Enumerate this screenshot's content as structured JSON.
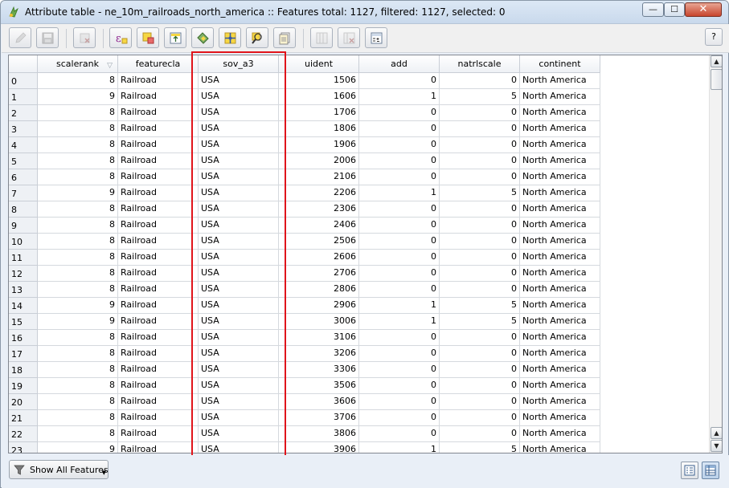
{
  "window": {
    "title": "Attribute table - ne_10m_railroads_north_america :: Features total: 1127, filtered: 1127, selected: 0",
    "min_glyph": "—",
    "max_glyph": "☐",
    "close_glyph": "✕"
  },
  "toolbar": {
    "buttons": [
      {
        "icon": "pencil-icon",
        "enabled": false
      },
      {
        "icon": "save-icon",
        "enabled": false
      },
      {
        "icon": "delete-selected-icon",
        "enabled": false
      },
      {
        "icon": "expression-select-icon",
        "enabled": true
      },
      {
        "icon": "deselect-all-icon",
        "enabled": true
      },
      {
        "icon": "move-selection-top-icon",
        "enabled": true
      },
      {
        "icon": "invert-selection-icon",
        "enabled": true
      },
      {
        "icon": "pan-to-selected-icon",
        "enabled": true
      },
      {
        "icon": "zoom-to-selected-icon",
        "enabled": true
      },
      {
        "icon": "copy-rows-icon",
        "enabled": true
      },
      {
        "icon": "new-column-icon",
        "enabled": false
      },
      {
        "icon": "delete-column-icon",
        "enabled": false
      },
      {
        "icon": "field-calculator-icon",
        "enabled": true
      }
    ],
    "help_label": "?"
  },
  "table": {
    "columns": [
      "scalerank",
      "featurecla",
      "sov_a3",
      "uident",
      "add",
      "natrlscale",
      "continent"
    ],
    "sorted_column": "scalerank",
    "rows": [
      {
        "id": "0",
        "scalerank": "8",
        "featurecla": "Railroad",
        "sov_a3": "USA",
        "uident": "1506",
        "add": "0",
        "natrlscale": "0",
        "continent": "North America"
      },
      {
        "id": "1",
        "scalerank": "9",
        "featurecla": "Railroad",
        "sov_a3": "USA",
        "uident": "1606",
        "add": "1",
        "natrlscale": "5",
        "continent": "North America"
      },
      {
        "id": "2",
        "scalerank": "8",
        "featurecla": "Railroad",
        "sov_a3": "USA",
        "uident": "1706",
        "add": "0",
        "natrlscale": "0",
        "continent": "North America"
      },
      {
        "id": "3",
        "scalerank": "8",
        "featurecla": "Railroad",
        "sov_a3": "USA",
        "uident": "1806",
        "add": "0",
        "natrlscale": "0",
        "continent": "North America"
      },
      {
        "id": "4",
        "scalerank": "8",
        "featurecla": "Railroad",
        "sov_a3": "USA",
        "uident": "1906",
        "add": "0",
        "natrlscale": "0",
        "continent": "North America"
      },
      {
        "id": "5",
        "scalerank": "8",
        "featurecla": "Railroad",
        "sov_a3": "USA",
        "uident": "2006",
        "add": "0",
        "natrlscale": "0",
        "continent": "North America"
      },
      {
        "id": "6",
        "scalerank": "8",
        "featurecla": "Railroad",
        "sov_a3": "USA",
        "uident": "2106",
        "add": "0",
        "natrlscale": "0",
        "continent": "North America"
      },
      {
        "id": "7",
        "scalerank": "9",
        "featurecla": "Railroad",
        "sov_a3": "USA",
        "uident": "2206",
        "add": "1",
        "natrlscale": "5",
        "continent": "North America"
      },
      {
        "id": "8",
        "scalerank": "8",
        "featurecla": "Railroad",
        "sov_a3": "USA",
        "uident": "2306",
        "add": "0",
        "natrlscale": "0",
        "continent": "North America"
      },
      {
        "id": "9",
        "scalerank": "8",
        "featurecla": "Railroad",
        "sov_a3": "USA",
        "uident": "2406",
        "add": "0",
        "natrlscale": "0",
        "continent": "North America"
      },
      {
        "id": "10",
        "scalerank": "8",
        "featurecla": "Railroad",
        "sov_a3": "USA",
        "uident": "2506",
        "add": "0",
        "natrlscale": "0",
        "continent": "North America"
      },
      {
        "id": "11",
        "scalerank": "8",
        "featurecla": "Railroad",
        "sov_a3": "USA",
        "uident": "2606",
        "add": "0",
        "natrlscale": "0",
        "continent": "North America"
      },
      {
        "id": "12",
        "scalerank": "8",
        "featurecla": "Railroad",
        "sov_a3": "USA",
        "uident": "2706",
        "add": "0",
        "natrlscale": "0",
        "continent": "North America"
      },
      {
        "id": "13",
        "scalerank": "8",
        "featurecla": "Railroad",
        "sov_a3": "USA",
        "uident": "2806",
        "add": "0",
        "natrlscale": "0",
        "continent": "North America"
      },
      {
        "id": "14",
        "scalerank": "9",
        "featurecla": "Railroad",
        "sov_a3": "USA",
        "uident": "2906",
        "add": "1",
        "natrlscale": "5",
        "continent": "North America"
      },
      {
        "id": "15",
        "scalerank": "9",
        "featurecla": "Railroad",
        "sov_a3": "USA",
        "uident": "3006",
        "add": "1",
        "natrlscale": "5",
        "continent": "North America"
      },
      {
        "id": "16",
        "scalerank": "8",
        "featurecla": "Railroad",
        "sov_a3": "USA",
        "uident": "3106",
        "add": "0",
        "natrlscale": "0",
        "continent": "North America"
      },
      {
        "id": "17",
        "scalerank": "8",
        "featurecla": "Railroad",
        "sov_a3": "USA",
        "uident": "3206",
        "add": "0",
        "natrlscale": "0",
        "continent": "North America"
      },
      {
        "id": "18",
        "scalerank": "8",
        "featurecla": "Railroad",
        "sov_a3": "USA",
        "uident": "3306",
        "add": "0",
        "natrlscale": "0",
        "continent": "North America"
      },
      {
        "id": "19",
        "scalerank": "8",
        "featurecla": "Railroad",
        "sov_a3": "USA",
        "uident": "3506",
        "add": "0",
        "natrlscale": "0",
        "continent": "North America"
      },
      {
        "id": "20",
        "scalerank": "8",
        "featurecla": "Railroad",
        "sov_a3": "USA",
        "uident": "3606",
        "add": "0",
        "natrlscale": "0",
        "continent": "North America"
      },
      {
        "id": "21",
        "scalerank": "8",
        "featurecla": "Railroad",
        "sov_a3": "USA",
        "uident": "3706",
        "add": "0",
        "natrlscale": "0",
        "continent": "North America"
      },
      {
        "id": "22",
        "scalerank": "8",
        "featurecla": "Railroad",
        "sov_a3": "USA",
        "uident": "3806",
        "add": "0",
        "natrlscale": "0",
        "continent": "North America"
      },
      {
        "id": "23",
        "scalerank": "9",
        "featurecla": "Railroad",
        "sov_a3": "USA",
        "uident": "3906",
        "add": "1",
        "natrlscale": "5",
        "continent": "North America"
      }
    ]
  },
  "bottom": {
    "show_features_label": "Show All Features",
    "form_view_icon": "form-view-icon",
    "table_view_icon": "table-view-icon"
  },
  "annotation": {
    "highlight_color": "#e0141b",
    "highlighted_column": "sov_a3"
  }
}
